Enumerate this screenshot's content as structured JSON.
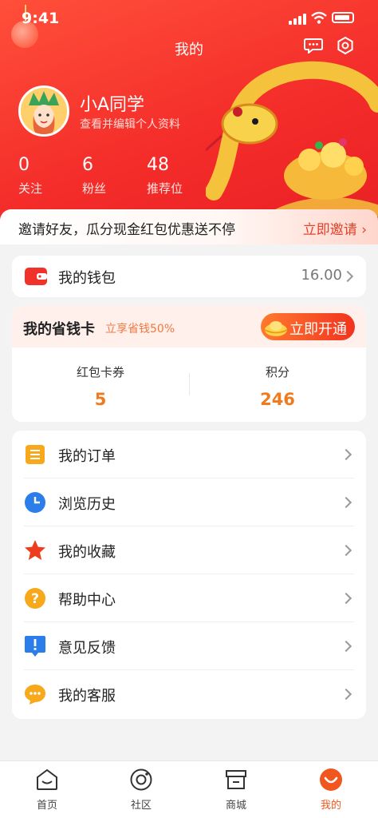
{
  "status_bar": {
    "time": "9:41"
  },
  "header": {
    "title": "我的"
  },
  "user": {
    "name": "小A同学",
    "edit_profile": "查看并编辑个人资料"
  },
  "stats": [
    {
      "value": "0",
      "label": "关注"
    },
    {
      "value": "6",
      "label": "粉丝"
    },
    {
      "value": "48",
      "label": "推荐位"
    }
  ],
  "invite_banner": {
    "text": "邀请好友，瓜分现金红包优惠送不停",
    "action": "立即邀请"
  },
  "wallet": {
    "label": "我的钱包",
    "value": "16.00"
  },
  "saving_card": {
    "title": "我的省钱卡",
    "subtitle": "立享省钱50%",
    "button": "立即开通",
    "items": [
      {
        "label": "红包卡券",
        "value": "5"
      },
      {
        "label": "积分",
        "value": "246"
      }
    ]
  },
  "menu": [
    {
      "label": "我的订单",
      "icon": "order-icon"
    },
    {
      "label": "浏览历史",
      "icon": "clock-icon"
    },
    {
      "label": "我的收藏",
      "icon": "star-icon"
    },
    {
      "label": "帮助中心",
      "icon": "question-icon"
    },
    {
      "label": "意见反馈",
      "icon": "feedback-icon"
    },
    {
      "label": "我的客服",
      "icon": "chat-icon"
    }
  ],
  "tabs": [
    {
      "label": "首页",
      "icon": "home-icon"
    },
    {
      "label": "社区",
      "icon": "community-icon"
    },
    {
      "label": "商城",
      "icon": "shop-icon"
    },
    {
      "label": "我的",
      "icon": "profile-icon",
      "active": true
    }
  ],
  "colors": {
    "brand_red": "#f42d2a",
    "accent_orange": "#f07a1c",
    "background": "#f3f3f3"
  }
}
